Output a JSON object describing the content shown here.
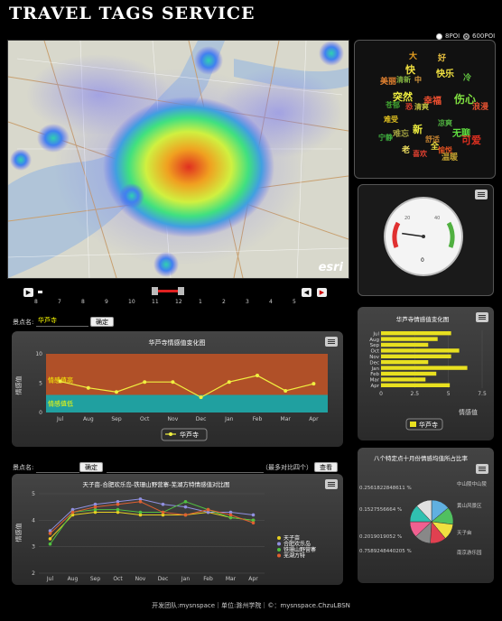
{
  "app": {
    "title": "TRAVEL TAGS SERVICE"
  },
  "poi_options": {
    "option1": "8POI",
    "option2": "600POI"
  },
  "map": {
    "logo": "esri"
  },
  "timeline": {
    "ticks": [
      "8",
      "7",
      "8",
      "9",
      "10",
      "11",
      "12",
      "1",
      "2",
      "3",
      "4",
      "5"
    ]
  },
  "tag_cloud": [
    {
      "text": "大",
      "color": "#e8a020"
    },
    {
      "text": "好",
      "color": "#e8c040"
    },
    {
      "text": "快",
      "color": "#f0e040"
    },
    {
      "text": "快乐",
      "color": "#f0e040"
    },
    {
      "text": "冷",
      "color": "#60c040"
    },
    {
      "text": "美丽",
      "color": "#e08030"
    },
    {
      "text": "清新",
      "color": "#80b040"
    },
    {
      "text": "中",
      "color": "#e0a040"
    },
    {
      "text": "突然",
      "color": "#f0f040"
    },
    {
      "text": "幸福",
      "color": "#f05030"
    },
    {
      "text": "伤心",
      "color": "#80e040"
    },
    {
      "text": "苍郁",
      "color": "#40a030"
    },
    {
      "text": "恐",
      "color": "#e04030"
    },
    {
      "text": "清爽",
      "color": "#c0c040"
    },
    {
      "text": "浪漫",
      "color": "#e05030"
    },
    {
      "text": "新",
      "color": "#f0f040"
    },
    {
      "text": "难受",
      "color": "#e0c020"
    },
    {
      "text": "凉爽",
      "color": "#50b040"
    },
    {
      "text": "难忘",
      "color": "#a0a040"
    },
    {
      "text": "无聊",
      "color": "#60e040"
    },
    {
      "text": "可爱",
      "color": "#e03020"
    },
    {
      "text": "宁静",
      "color": "#40b040"
    },
    {
      "text": "舒适",
      "color": "#c08030"
    },
    {
      "text": "老",
      "color": "#f0e060"
    },
    {
      "text": "愉悦",
      "color": "#e05020"
    },
    {
      "text": "全",
      "color": "#f0e040"
    },
    {
      "text": "喜欢",
      "color": "#e04030"
    },
    {
      "text": "温暖",
      "color": "#c0a030"
    }
  ],
  "gauge": {
    "value": "0",
    "ticks": [
      "0",
      "20",
      "40",
      "60",
      "80"
    ],
    "level": 0.15
  },
  "section1": {
    "label": "景点名:",
    "input": "华芦寺",
    "confirm": "确定",
    "chart_title": "华芦寺情感值变化图",
    "band_high": "情感值高",
    "band_low": "情感值低",
    "ylabel": "情感值",
    "legend": "华芦寺"
  },
  "section2": {
    "label": "景点名:",
    "confirm": "确定",
    "hint": "（最多对比四个）",
    "view": "查看",
    "chart_title": "天子亩-合肥欢乐岛-铁珊山野营寨-芜湖方特情感值对比图",
    "ylabel": "情感值",
    "legend": [
      "天子亩",
      "合肥欢乐岛",
      "铁珊山野营寨",
      "芜湖方特"
    ]
  },
  "right1": {
    "chart_title": "华芦寺情感值变化图",
    "legend": "华芦寺",
    "xlabel": "情感值"
  },
  "right2": {
    "chart_title": "八个特定点十月份情感均值所占比率",
    "labels_left": [
      "0.2561822848611 %",
      "0.1527556664 %",
      "0.2019019052 %",
      "0.7589248440205 %"
    ],
    "labels_right": [
      "中山陵中山陵",
      "黄山风景区",
      "天子亩",
      "南京游乐园"
    ]
  },
  "footer": {
    "text": "开发团队:mysnspace｜单位:滁州学院｜©：mysnspace.ChzuLBSN"
  },
  "chart_data": [
    {
      "type": "line",
      "title": "华芦寺情感值变化图",
      "categories": [
        "Jul",
        "Aug",
        "Sep",
        "Oct",
        "Nov",
        "Dec",
        "Jan",
        "Feb",
        "Mar",
        "Apr"
      ],
      "series": [
        {
          "name": "华芦寺",
          "values": [
            5.3,
            4.2,
            3.5,
            5.2,
            5.2,
            2.6,
            5.2,
            6.3,
            3.7,
            4.9
          ]
        }
      ],
      "ylabel": "情感值",
      "ylim": [
        0,
        10
      ],
      "yticks": [
        0,
        5,
        10
      ]
    },
    {
      "type": "line",
      "title": "天子亩-合肥欢乐岛-铁珊山野营寨-芜湖方特情感值对比图",
      "categories": [
        "Jul",
        "Aug",
        "Sep",
        "Oct",
        "Nov",
        "Dec",
        "Jan",
        "Feb",
        "Mar",
        "Apr"
      ],
      "series": [
        {
          "name": "天子亩",
          "color": "#e8d020",
          "values": [
            3.3,
            4.2,
            4.3,
            4.3,
            4.2,
            4.2,
            4.2,
            4.3,
            4.1,
            4.0
          ]
        },
        {
          "name": "合肥欢乐岛",
          "color": "#9090e0",
          "values": [
            3.6,
            4.4,
            4.6,
            4.7,
            4.8,
            4.6,
            4.5,
            4.3,
            4.3,
            4.2
          ]
        },
        {
          "name": "铁珊山野营寨",
          "color": "#50c040",
          "values": [
            3.1,
            4.3,
            4.4,
            4.4,
            4.3,
            4.3,
            4.7,
            4.4,
            4.1,
            4.0
          ]
        },
        {
          "name": "芜湖方特",
          "color": "#e06030",
          "values": [
            3.5,
            4.3,
            4.5,
            4.6,
            4.7,
            4.3,
            4.2,
            4.4,
            4.2,
            3.9
          ]
        }
      ],
      "ylabel": "情感值",
      "ylim": [
        2,
        5
      ],
      "yticks": [
        2,
        3,
        4,
        5
      ]
    },
    {
      "type": "bar",
      "title": "华芦寺情感值变化图",
      "categories": [
        "Jul",
        "Aug",
        "Sep",
        "Oct",
        "Nov",
        "Dec",
        "Jan",
        "Feb",
        "Mar",
        "Apr"
      ],
      "series": [
        {
          "name": "华芦寺",
          "values": [
            5.2,
            4.2,
            3.5,
            5.8,
            5.2,
            3.5,
            6.4,
            4.1,
            3.3,
            5.1
          ]
        }
      ],
      "xlabel": "情感值",
      "xlim": [
        0,
        7.5
      ],
      "xticks": [
        0,
        2.5,
        5,
        7.5
      ]
    },
    {
      "type": "pie",
      "title": "八个特定点十月份情感均值所占比率",
      "slices": [
        {
          "value": 14,
          "color": "#60b0e0"
        },
        {
          "value": 13,
          "color": "#50c060"
        },
        {
          "value": 12,
          "color": "#f0e040"
        },
        {
          "value": 12,
          "color": "#e04050"
        },
        {
          "value": 12,
          "color": "#888888"
        },
        {
          "value": 12,
          "color": "#f06090"
        },
        {
          "value": 13,
          "color": "#30c0b0"
        },
        {
          "value": 12,
          "color": "#e0e0e0"
        }
      ]
    }
  ]
}
